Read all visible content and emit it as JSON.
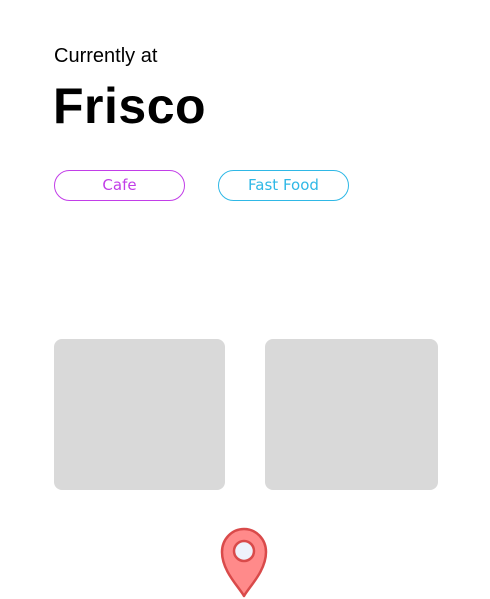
{
  "header": {
    "subtitle": "Currently at",
    "location_name": "Frisco"
  },
  "tags": [
    {
      "label": "Cafe",
      "color": "#c23ee8"
    },
    {
      "label": "Fast Food",
      "color": "#2fb8e6"
    }
  ],
  "cards": [
    {
      "name": "place-card-1",
      "color": "#d9d9d9"
    },
    {
      "name": "place-card-2",
      "color": "#d9d9d9"
    }
  ],
  "map_pin": {
    "icon": "map-pin-icon",
    "fill_color": "#ff8a8a",
    "stroke_color": "#d94a4a",
    "center_color": "#eef2fb"
  }
}
